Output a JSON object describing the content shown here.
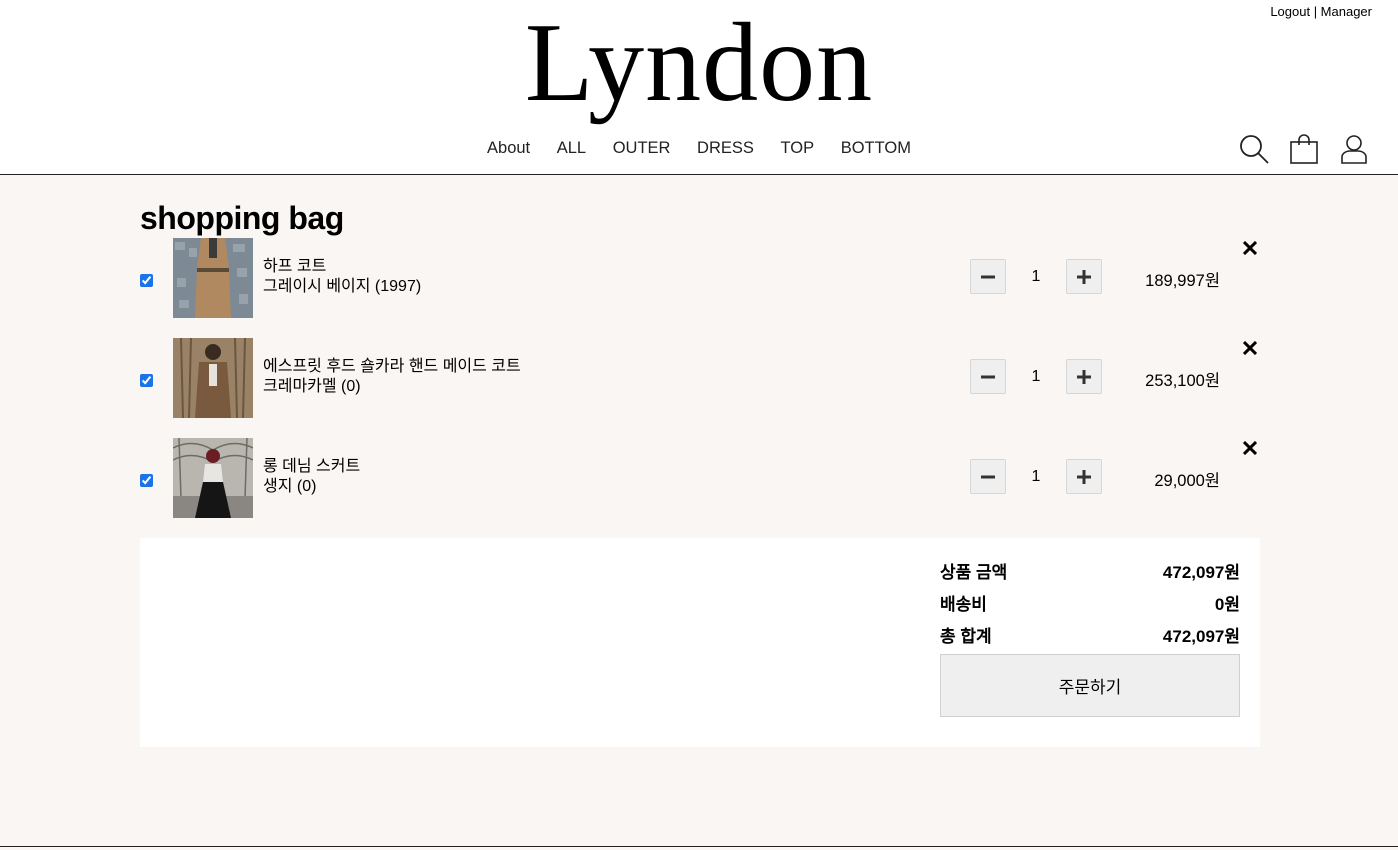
{
  "header": {
    "logo": "Lyndon",
    "top_links": {
      "logout": "Logout",
      "manager": " | Manager"
    },
    "nav": [
      "About",
      "ALL",
      "OUTER",
      "DRESS",
      "TOP",
      "BOTTOM"
    ],
    "icons": [
      "search-icon",
      "shopping-bag-icon",
      "user-icon"
    ]
  },
  "page_title": "shopping bag",
  "cart": {
    "items": [
      {
        "name": "하프 코트",
        "option": "그레이시 베이지 (1997)",
        "quantity": "1",
        "price": "189,997원",
        "checked": true
      },
      {
        "name": "에스프릿 후드 숄카라 핸드 메이드 코트",
        "option": "크레마카멜 (0)",
        "quantity": "1",
        "price": "253,100원",
        "checked": true
      },
      {
        "name": "롱 데님 스커트",
        "option": "생지 (0)",
        "quantity": "1",
        "price": "29,000원",
        "checked": true
      }
    ]
  },
  "summary": {
    "subtotal_label": "상품 금액",
    "subtotal_value": "472,097원",
    "shipping_label": "배송비",
    "shipping_value": "0원",
    "total_label": "총 합계",
    "total_value": "472,097원",
    "order_button": "주문하기"
  },
  "colors": {
    "background": "#f9f6f3",
    "header": "#ffffff",
    "checkbox": "#1a73e8"
  }
}
